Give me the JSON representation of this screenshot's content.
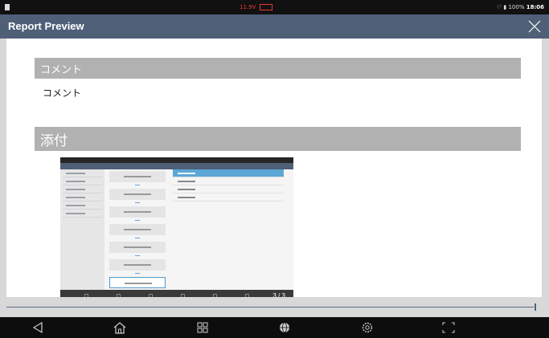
{
  "status_bar": {
    "voltage": "11.9V",
    "battery": "100%",
    "time": "18:06"
  },
  "window": {
    "title": "Report Preview"
  },
  "sections": {
    "comment_heading": "コメント",
    "comment_text": "コメント",
    "attachment_heading": "添付"
  },
  "attachment": {
    "page_indicator": "3 / 3"
  },
  "nav_bar": {
    "icons": [
      "back-icon",
      "home-icon",
      "recent-apps-icon",
      "globe-icon",
      "settings-icon",
      "screenshot-icon"
    ]
  },
  "colors": {
    "title_bar": "#4f5f78",
    "section_header": "#b1b1b1",
    "status_voltage": "#e53b2f"
  }
}
